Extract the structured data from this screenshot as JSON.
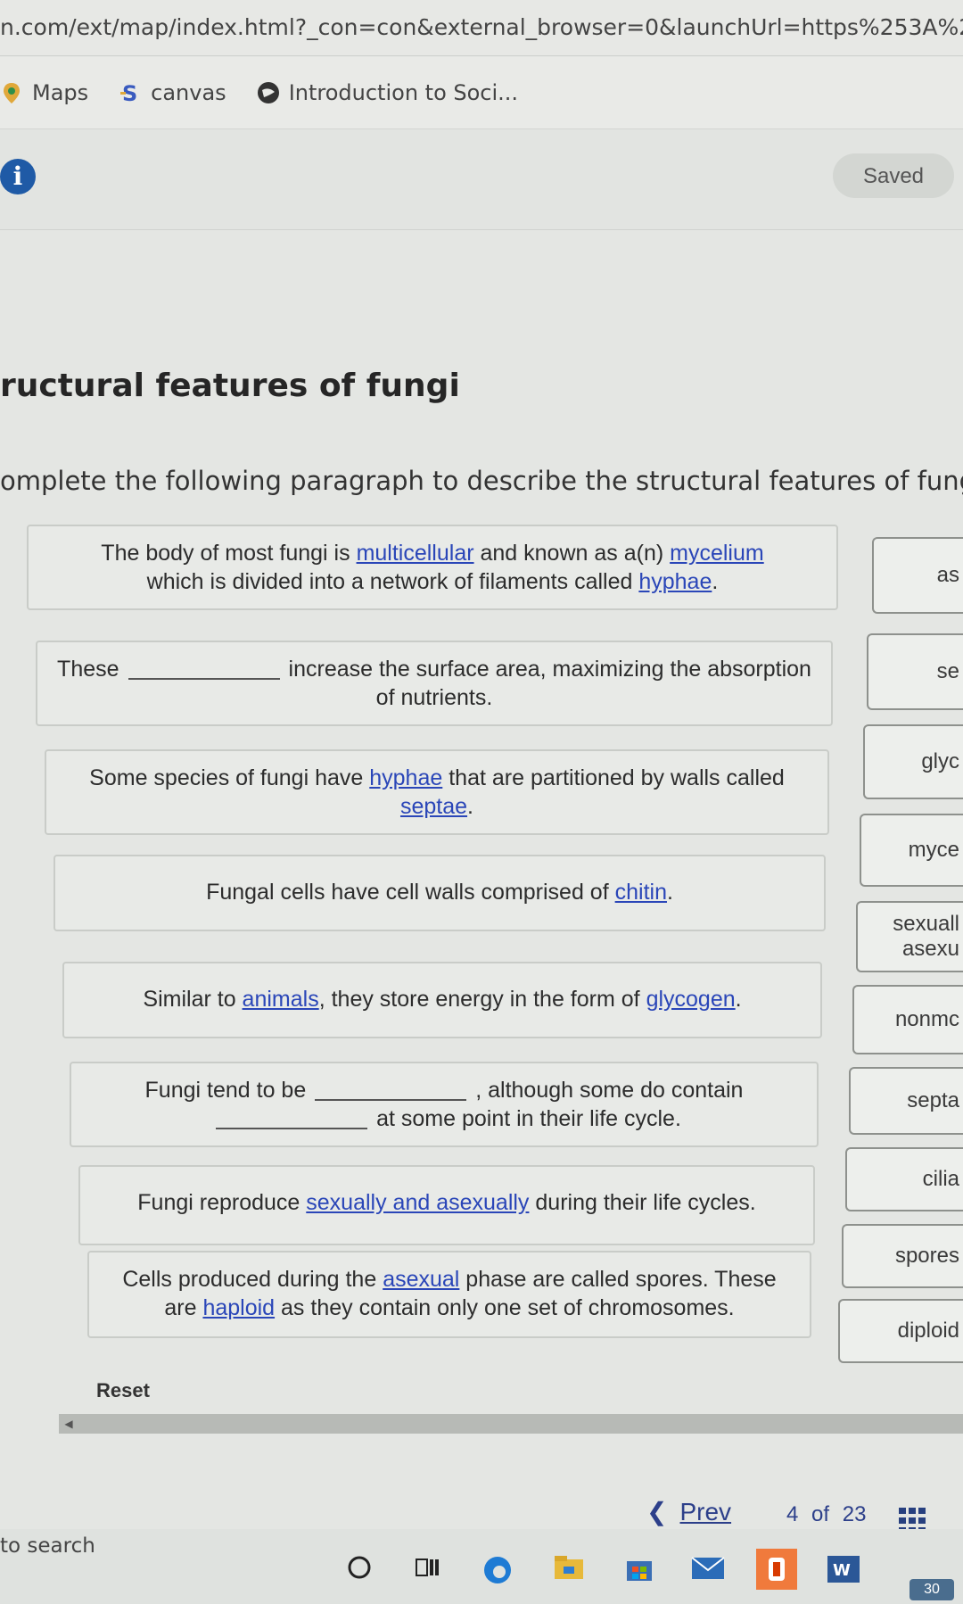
{
  "browser": {
    "url": "n.com/ext/map/index.html?_con=con&external_browser=0&launchUrl=https%253A%2",
    "bookmarks": [
      {
        "label": "Maps",
        "icon": "maps-pin-icon"
      },
      {
        "label": "canvas",
        "icon": "canvas-icon"
      },
      {
        "label": "Introduction to Soci...",
        "icon": "globe-icon"
      }
    ]
  },
  "header": {
    "saved_label": "Saved",
    "info_glyph": "i"
  },
  "page": {
    "title": "ructural features of fungi",
    "instructions": "omplete the following paragraph to describe the structural features of fungi."
  },
  "statements": [
    {
      "parts": [
        "The body of most fungi is ",
        "multicellular",
        " and known as a(n) ",
        "mycelium",
        ",\nwhich is divided into a network of filaments called ",
        "hyphae",
        "."
      ]
    },
    {
      "before": "These",
      "after": "increase the surface area, maximizing the absorption of nutrients."
    },
    {
      "parts": [
        "Some species of fungi have ",
        "hyphae",
        " that are partitioned by walls called ",
        "septae",
        "."
      ]
    },
    {
      "parts": [
        "Fungal cells have cell walls comprised of ",
        "chitin",
        "."
      ]
    },
    {
      "parts": [
        "Similar to ",
        "animals",
        ", they store energy in the form of ",
        "glycogen",
        "."
      ]
    },
    {
      "before": "Fungi tend to be",
      "middle": ", although some do contain",
      "after": "at some point in their life cycle."
    },
    {
      "parts": [
        "Fungi reproduce ",
        "sexually and asexually",
        " during their life cycles."
      ]
    },
    {
      "parts": [
        "Cells produced during the ",
        "asexual",
        " phase are called spores. These are ",
        "haploid",
        " as they contain only one set of chromosomes."
      ]
    }
  ],
  "answer_tiles": [
    {
      "line1": "as",
      "line2": ""
    },
    {
      "line1": "se",
      "line2": ""
    },
    {
      "line1": "glyc",
      "line2": ""
    },
    {
      "line1": "myce",
      "line2": ""
    },
    {
      "line1": "sexuall",
      "line2": "asexu"
    },
    {
      "line1": "nonmc",
      "line2": ""
    },
    {
      "line1": "septa",
      "line2": ""
    },
    {
      "line1": "cilia",
      "line2": ""
    },
    {
      "line1": "spores",
      "line2": ""
    },
    {
      "line1": "diploid",
      "line2": ""
    }
  ],
  "controls": {
    "reset_label": "Reset",
    "prev_label": "Prev",
    "page_current": "4",
    "page_of": "of",
    "page_total": "23"
  },
  "taskbar": {
    "search_text": "to search",
    "battery": "30"
  }
}
